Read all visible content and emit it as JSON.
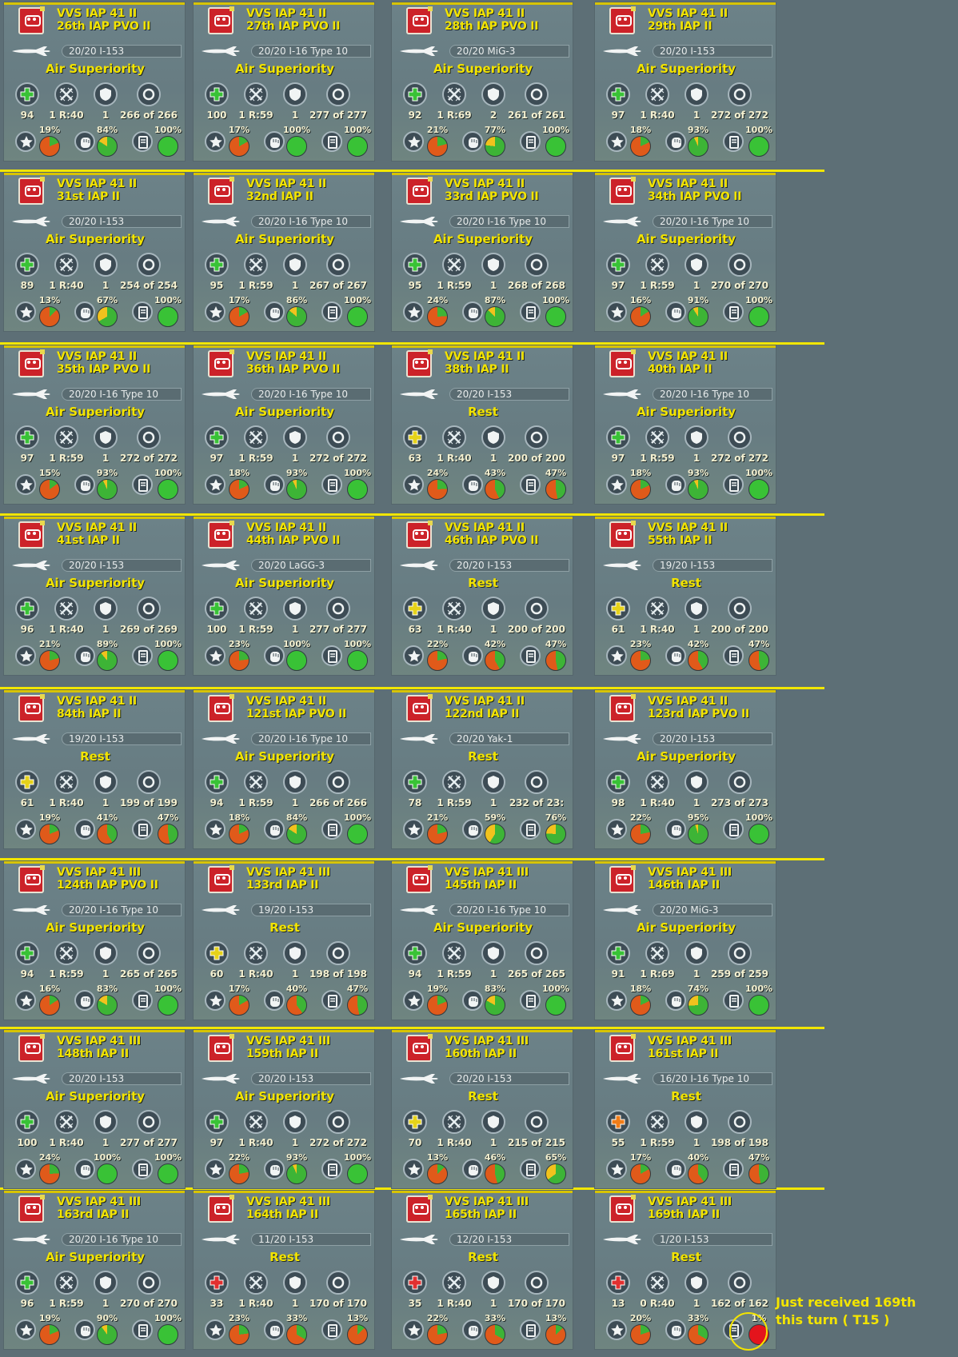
{
  "colors": {
    "separator": "#f2e600",
    "title_text": "#f3e400",
    "badge_red": "#cc2229",
    "health_green": "#39c236",
    "health_yellow": "#e6d21a",
    "health_orange": "#f07d19",
    "health_red": "#e23030"
  },
  "icons": {
    "status": "plus-icon",
    "exp": "crossed-swords-icon",
    "defense": "shield-icon",
    "ammo": "ring-icon",
    "morale": "star-icon",
    "fatigue": "fist-icon",
    "supply": "canister-icon"
  },
  "rows": [
    [
      {
        "corps": "VVS IAP 41 II",
        "unit": "26th IAP PVO II",
        "aircraft": "20/20 I-153",
        "mission": "Air Superiority",
        "status": "green",
        "v1": "94",
        "v2": "1 R:40",
        "v3": "1",
        "v4": "266 of 266",
        "p1": 19,
        "p2": 84,
        "p3": 100
      },
      {
        "corps": "VVS IAP 41 II",
        "unit": "27th IAP PVO II",
        "aircraft": "20/20 I-16 Type 10",
        "mission": "Air Superiority",
        "status": "green",
        "v1": "100",
        "v2": "1 R:59",
        "v3": "1",
        "v4": "277 of 277",
        "p1": 17,
        "p2": 100,
        "p3": 100
      },
      {
        "corps": "VVS IAP 41 II",
        "unit": "28th IAP PVO II",
        "aircraft": "20/20 MiG-3",
        "mission": "Air Superiority",
        "status": "green",
        "v1": "92",
        "v2": "1 R:69",
        "v3": "2",
        "v4": "261 of 261",
        "p1": 21,
        "p2": 77,
        "p3": 100
      },
      {
        "corps": "VVS IAP 41 II",
        "unit": "29th IAP II",
        "aircraft": "20/20 I-153",
        "mission": "Air Superiority",
        "status": "green",
        "v1": "97",
        "v2": "1 R:40",
        "v3": "1",
        "v4": "272 of 272",
        "p1": 18,
        "p2": 93,
        "p3": 100
      }
    ],
    [
      {
        "corps": "VVS IAP 41 II",
        "unit": "31st IAP II",
        "aircraft": "20/20 I-153",
        "mission": "Air Superiority",
        "status": "green",
        "v1": "89",
        "v2": "1 R:40",
        "v3": "1",
        "v4": "254 of 254",
        "p1": 13,
        "p2": 67,
        "p3": 100
      },
      {
        "corps": "VVS IAP 41 II",
        "unit": "32nd IAP II",
        "aircraft": "20/20 I-16 Type 10",
        "mission": "Air Superiority",
        "status": "green",
        "v1": "95",
        "v2": "1 R:59",
        "v3": "1",
        "v4": "267 of 267",
        "p1": 17,
        "p2": 86,
        "p3": 100
      },
      {
        "corps": "VVS IAP 41 II",
        "unit": "33rd IAP PVO II",
        "aircraft": "20/20 I-16 Type 10",
        "mission": "Air Superiority",
        "status": "green",
        "v1": "95",
        "v2": "1 R:59",
        "v3": "1",
        "v4": "268 of 268",
        "p1": 24,
        "p2": 87,
        "p3": 100
      },
      {
        "corps": "VVS IAP 41 II",
        "unit": "34th IAP PVO II",
        "aircraft": "20/20 I-16 Type 10",
        "mission": "Air Superiority",
        "status": "green",
        "v1": "97",
        "v2": "1 R:59",
        "v3": "1",
        "v4": "270 of 270",
        "p1": 16,
        "p2": 91,
        "p3": 100
      }
    ],
    [
      {
        "corps": "VVS IAP 41 II",
        "unit": "35th IAP PVO II",
        "aircraft": "20/20 I-16 Type 10",
        "mission": "Air Superiority",
        "status": "green",
        "v1": "97",
        "v2": "1 R:59",
        "v3": "1",
        "v4": "272 of 272",
        "p1": 15,
        "p2": 93,
        "p3": 100
      },
      {
        "corps": "VVS IAP 41 II",
        "unit": "36th IAP PVO II",
        "aircraft": "20/20 I-16 Type 10",
        "mission": "Air Superiority",
        "status": "green",
        "v1": "97",
        "v2": "1 R:59",
        "v3": "1",
        "v4": "272 of 272",
        "p1": 18,
        "p2": 93,
        "p3": 100
      },
      {
        "corps": "VVS IAP 41 II",
        "unit": "38th IAP II",
        "aircraft": "20/20 I-153",
        "mission": "Rest",
        "status": "yellow",
        "v1": "63",
        "v2": "1 R:40",
        "v3": "1",
        "v4": "200 of 200",
        "p1": 24,
        "p2": 43,
        "p3": 47
      },
      {
        "corps": "VVS IAP 41 II",
        "unit": "40th IAP II",
        "aircraft": "20/20 I-16 Type 10",
        "mission": "Air Superiority",
        "status": "green",
        "v1": "97",
        "v2": "1 R:59",
        "v3": "1",
        "v4": "272 of 272",
        "p1": 18,
        "p2": 93,
        "p3": 100
      }
    ],
    [
      {
        "corps": "VVS IAP 41 II",
        "unit": "41st IAP II",
        "aircraft": "20/20 I-153",
        "mission": "Air Superiority",
        "status": "green",
        "v1": "96",
        "v2": "1 R:40",
        "v3": "1",
        "v4": "269 of 269",
        "p1": 21,
        "p2": 89,
        "p3": 100
      },
      {
        "corps": "VVS IAP 41 II",
        "unit": "44th IAP PVO II",
        "aircraft": "20/20 LaGG-3",
        "mission": "Air Superiority",
        "status": "green",
        "v1": "100",
        "v2": "1 R:59",
        "v3": "1",
        "v4": "277 of 277",
        "p1": 23,
        "p2": 100,
        "p3": 100
      },
      {
        "corps": "VVS IAP 41 II",
        "unit": "46th IAP PVO II",
        "aircraft": "20/20 I-153",
        "mission": "Rest",
        "status": "yellow",
        "v1": "63",
        "v2": "1 R:40",
        "v3": "1",
        "v4": "200 of 200",
        "p1": 22,
        "p2": 42,
        "p3": 47
      },
      {
        "corps": "VVS IAP 41 II",
        "unit": "55th IAP II",
        "aircraft": "19/20 I-153",
        "mission": "Rest",
        "status": "yellow",
        "v1": "61",
        "v2": "1 R:40",
        "v3": "1",
        "v4": "200 of 200",
        "p1": 23,
        "p2": 42,
        "p3": 47
      }
    ],
    [
      {
        "corps": "VVS IAP 41 II",
        "unit": "84th IAP II",
        "aircraft": "19/20 I-153",
        "mission": "Rest",
        "status": "yellow",
        "v1": "61",
        "v2": "1 R:40",
        "v3": "1",
        "v4": "199 of 199",
        "p1": 19,
        "p2": 41,
        "p3": 47
      },
      {
        "corps": "VVS IAP 41 II",
        "unit": "121st IAP PVO II",
        "aircraft": "20/20 I-16 Type 10",
        "mission": "Air Superiority",
        "status": "green",
        "v1": "94",
        "v2": "1 R:59",
        "v3": "1",
        "v4": "266 of 266",
        "p1": 18,
        "p2": 84,
        "p3": 100
      },
      {
        "corps": "VVS IAP 41 II",
        "unit": "122nd IAP II",
        "aircraft": "20/20 Yak-1",
        "mission": "Rest",
        "status": "green",
        "v1": "78",
        "v2": "1 R:59",
        "v3": "1",
        "v4": "232 of 23:",
        "p1": 21,
        "p2": 59,
        "p3": 76
      },
      {
        "corps": "VVS IAP 41 II",
        "unit": "123rd IAP PVO II",
        "aircraft": "20/20 I-153",
        "mission": "Air Superiority",
        "status": "green",
        "v1": "98",
        "v2": "1 R:40",
        "v3": "1",
        "v4": "273 of 273",
        "p1": 22,
        "p2": 95,
        "p3": 100
      }
    ],
    [
      {
        "corps": "VVS IAP 41 III",
        "unit": "124th IAP PVO II",
        "aircraft": "20/20 I-16 Type 10",
        "mission": "Air Superiority",
        "status": "green",
        "v1": "94",
        "v2": "1 R:59",
        "v3": "1",
        "v4": "265 of 265",
        "p1": 16,
        "p2": 83,
        "p3": 100
      },
      {
        "corps": "VVS IAP 41 III",
        "unit": "133rd IAP II",
        "aircraft": "19/20 I-153",
        "mission": "Rest",
        "status": "yellow",
        "v1": "60",
        "v2": "1 R:40",
        "v3": "1",
        "v4": "198 of 198",
        "p1": 17,
        "p2": 40,
        "p3": 47
      },
      {
        "corps": "VVS IAP 41 III",
        "unit": "145th IAP II",
        "aircraft": "20/20 I-16 Type 10",
        "mission": "Air Superiority",
        "status": "green",
        "v1": "94",
        "v2": "1 R:59",
        "v3": "1",
        "v4": "265 of 265",
        "p1": 19,
        "p2": 83,
        "p3": 100
      },
      {
        "corps": "VVS IAP 41 III",
        "unit": "146th IAP II",
        "aircraft": "20/20 MiG-3",
        "mission": "Air Superiority",
        "status": "green",
        "v1": "91",
        "v2": "1 R:69",
        "v3": "1",
        "v4": "259 of 259",
        "p1": 18,
        "p2": 74,
        "p3": 100
      }
    ],
    [
      {
        "corps": "VVS IAP 41 III",
        "unit": "148th IAP II",
        "aircraft": "20/20 I-153",
        "mission": "Air Superiority",
        "status": "green",
        "v1": "100",
        "v2": "1 R:40",
        "v3": "1",
        "v4": "277 of 277",
        "p1": 24,
        "p2": 100,
        "p3": 100
      },
      {
        "corps": "VVS IAP 41 III",
        "unit": "159th IAP II",
        "aircraft": "20/20 I-153",
        "mission": "Air Superiority",
        "status": "green",
        "v1": "97",
        "v2": "1 R:40",
        "v3": "1",
        "v4": "272 of 272",
        "p1": 22,
        "p2": 93,
        "p3": 100
      },
      {
        "corps": "VVS IAP 41 III",
        "unit": "160th IAP II",
        "aircraft": "20/20 I-153",
        "mission": "Rest",
        "status": "yellow",
        "v1": "70",
        "v2": "1 R:40",
        "v3": "1",
        "v4": "215 of 215",
        "p1": 13,
        "p2": 46,
        "p3": 65
      },
      {
        "corps": "VVS IAP 41 III",
        "unit": "161st IAP II",
        "aircraft": "16/20 I-16 Type 10",
        "mission": "Rest",
        "status": "orange",
        "v1": "55",
        "v2": "1 R:59",
        "v3": "1",
        "v4": "198 of 198",
        "p1": 17,
        "p2": 40,
        "p3": 47
      }
    ],
    [
      {
        "corps": "VVS IAP 41 III",
        "unit": "163rd IAP II",
        "aircraft": "20/20 I-16 Type 10",
        "mission": "Air Superiority",
        "status": "green",
        "v1": "96",
        "v2": "1 R:59",
        "v3": "1",
        "v4": "270 of 270",
        "p1": 19,
        "p2": 90,
        "p3": 100
      },
      {
        "corps": "VVS IAP 41 III",
        "unit": "164th IAP II",
        "aircraft": "11/20 I-153",
        "mission": "Rest",
        "status": "red",
        "v1": "33",
        "v2": "1 R:40",
        "v3": "1",
        "v4": "170 of 170",
        "p1": 23,
        "p2": 33,
        "p3": 13
      },
      {
        "corps": "VVS IAP 41 III",
        "unit": "165th IAP II",
        "aircraft": "12/20 I-153",
        "mission": "Rest",
        "status": "red",
        "v1": "35",
        "v2": "1 R:40",
        "v3": "1",
        "v4": "170 of 170",
        "p1": 22,
        "p2": 33,
        "p3": 13
      },
      {
        "corps": "VVS IAP 41 III",
        "unit": "169th IAP II",
        "aircraft": "1/20 I-153",
        "mission": "Rest",
        "status": "red",
        "v1": "13",
        "v2": "0 R:40",
        "v3": "1",
        "v4": "162 of 162",
        "p1": 20,
        "p2": 33,
        "p3": 1
      }
    ]
  ],
  "annotation": {
    "line1": "Just received 169th",
    "line2": "this turn ( T15 )"
  }
}
